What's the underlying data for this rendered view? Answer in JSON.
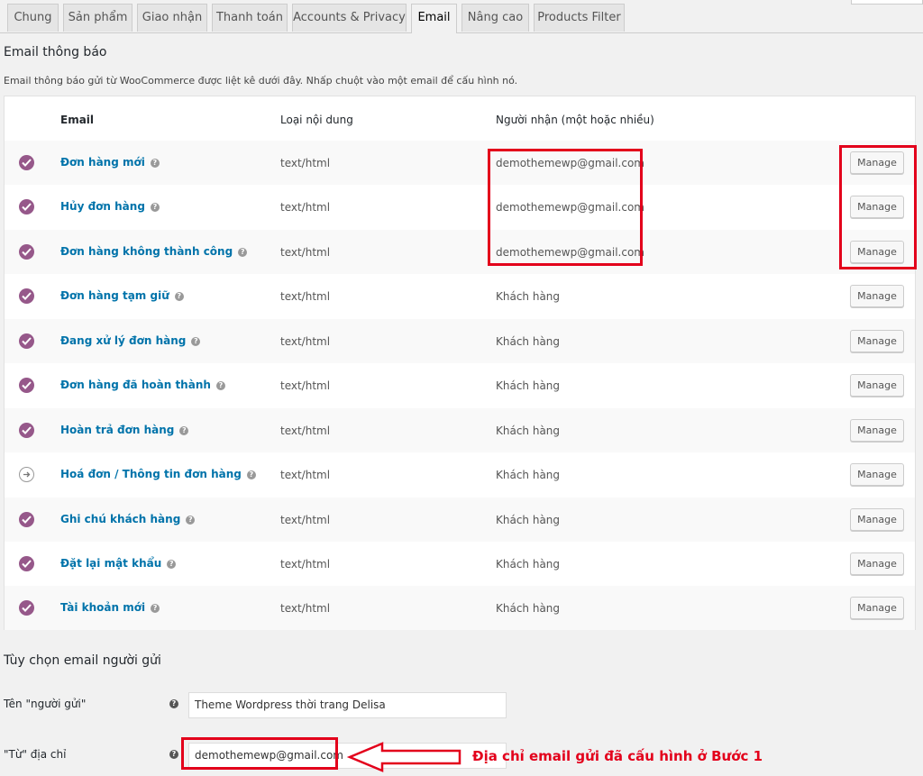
{
  "tabs": [
    {
      "label": "Chung"
    },
    {
      "label": "Sản phẩm"
    },
    {
      "label": "Giao nhận"
    },
    {
      "label": "Thanh toán"
    },
    {
      "label": "Accounts & Privacy"
    },
    {
      "label": "Email",
      "active": true
    },
    {
      "label": "Nâng cao"
    },
    {
      "label": "Products Filter"
    }
  ],
  "email_section": {
    "title": "Email thông báo",
    "description": "Email thông báo gửi từ WooCommerce được liệt kê dưới đây. Nhấp chuột vào một email để cấu hình nó."
  },
  "table": {
    "headers": {
      "email": "Email",
      "content_type": "Loại nội dung",
      "recipients": "Người nhận (một hoặc nhiều)"
    },
    "rows": [
      {
        "name": "Đơn hàng mới",
        "content_type": "text/html",
        "recipient": "demothemewp@gmail.com",
        "status": "enabled",
        "action": "Manage"
      },
      {
        "name": "Hủy đơn hàng",
        "content_type": "text/html",
        "recipient": "demothemewp@gmail.com",
        "status": "enabled",
        "action": "Manage"
      },
      {
        "name": "Đơn hàng không thành công",
        "content_type": "text/html",
        "recipient": "demothemewp@gmail.com",
        "status": "enabled",
        "action": "Manage"
      },
      {
        "name": "Đơn hàng tạm giữ",
        "content_type": "text/html",
        "recipient": "Khách hàng",
        "status": "enabled",
        "action": "Manage"
      },
      {
        "name": "Đang xử lý đơn hàng",
        "content_type": "text/html",
        "recipient": "Khách hàng",
        "status": "enabled",
        "action": "Manage"
      },
      {
        "name": "Đơn hàng đã hoàn thành",
        "content_type": "text/html",
        "recipient": "Khách hàng",
        "status": "enabled",
        "action": "Manage"
      },
      {
        "name": "Hoàn trả đơn hàng",
        "content_type": "text/html",
        "recipient": "Khách hàng",
        "status": "enabled",
        "action": "Manage"
      },
      {
        "name": "Hoá đơn / Thông tin đơn hàng",
        "content_type": "text/html",
        "recipient": "Khách hàng",
        "status": "manual",
        "action": "Manage"
      },
      {
        "name": "Ghi chú khách hàng",
        "content_type": "text/html",
        "recipient": "Khách hàng",
        "status": "enabled",
        "action": "Manage"
      },
      {
        "name": "Đặt lại mật khẩu",
        "content_type": "text/html",
        "recipient": "Khách hàng",
        "status": "enabled",
        "action": "Manage"
      },
      {
        "name": "Tài khoản mới",
        "content_type": "text/html",
        "recipient": "Khách hàng",
        "status": "enabled",
        "action": "Manage"
      }
    ]
  },
  "sender_section": {
    "title": "Tùy chọn email người gửi",
    "from_name_label": "Tên \"người gửi\"",
    "from_name_value": "Theme Wordpress thời trang Delisa",
    "from_address_label": "\"Từ\" địa chỉ",
    "from_address_value": "demothemewp@gmail.com"
  },
  "annotation": {
    "text": "Địa chỉ email gửi đã cấu hình ở Bước 1"
  },
  "colors": {
    "accent_purple": "#96588a",
    "link_blue": "#0073aa",
    "annotation_red": "#e3001b"
  }
}
